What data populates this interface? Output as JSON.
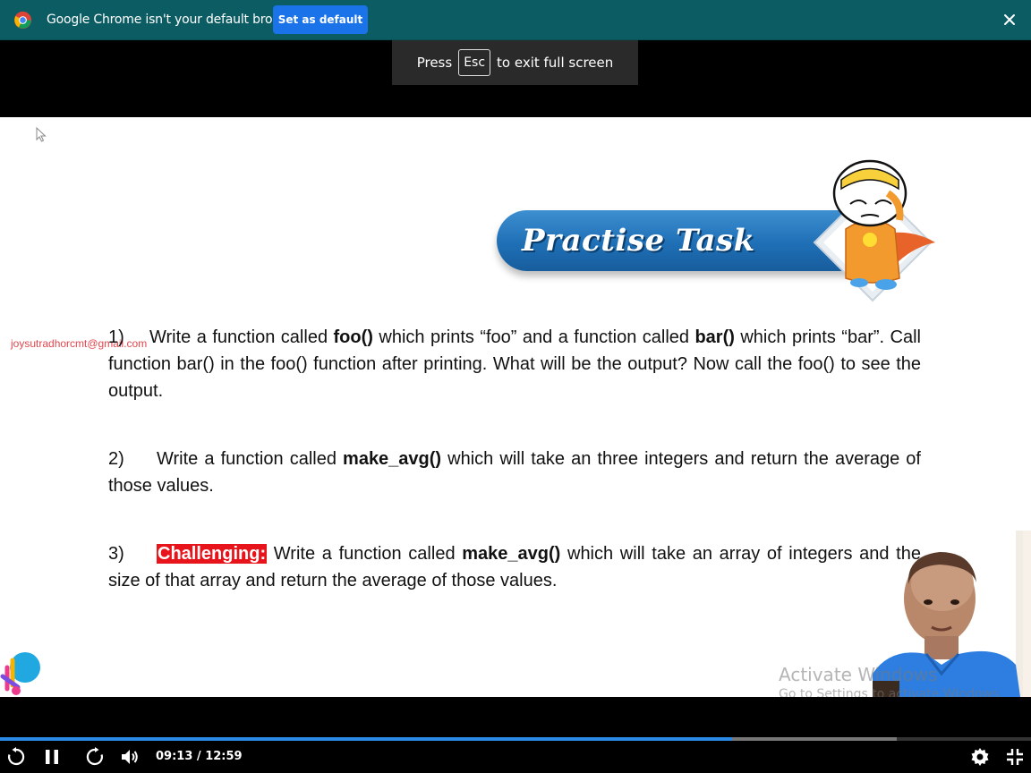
{
  "infobar": {
    "message": "Google Chrome isn't your default browser",
    "set_default_label": "Set as default"
  },
  "fullscreen_toast": {
    "prefix": "Press",
    "key": "Esc",
    "suffix": "to exit full screen"
  },
  "slide": {
    "banner_title": "Practise Task",
    "watermark_email": "joysutradhorcmt@gmail.com",
    "task1": {
      "num": "1)",
      "t1": "Write a function called ",
      "b1": "foo()",
      "t2": " which prints “foo” and a function called ",
      "b2": "bar()",
      "t3": " which prints “bar”. Call function bar() in the foo() function after printing. What will be the output? Now call the foo() to see the output."
    },
    "task2": {
      "num": "2)",
      "t1": "Write a function called ",
      "b1": "make_avg()",
      "t2": " which will take an three integers and return the average of those values."
    },
    "task3": {
      "num": "3)",
      "badge": "Challenging:",
      "t1": " Write a function called ",
      "b1": "make_avg()",
      "t2": " which will take an array of integers and the size of that array and return the average of those values."
    },
    "activate_title": "Activate Windows",
    "activate_sub": "Go to Settings to activate Windows."
  },
  "player": {
    "time_current": "09:13",
    "time_separator": " / ",
    "time_total": "12:59",
    "progress_played": 0.71,
    "progress_buffered": 0.87,
    "accent_color": "#2b8ae6",
    "icons": [
      "replay-icon",
      "pause-icon",
      "forward-icon",
      "volume-icon",
      "settings-icon",
      "exit-fullscreen-icon"
    ]
  }
}
